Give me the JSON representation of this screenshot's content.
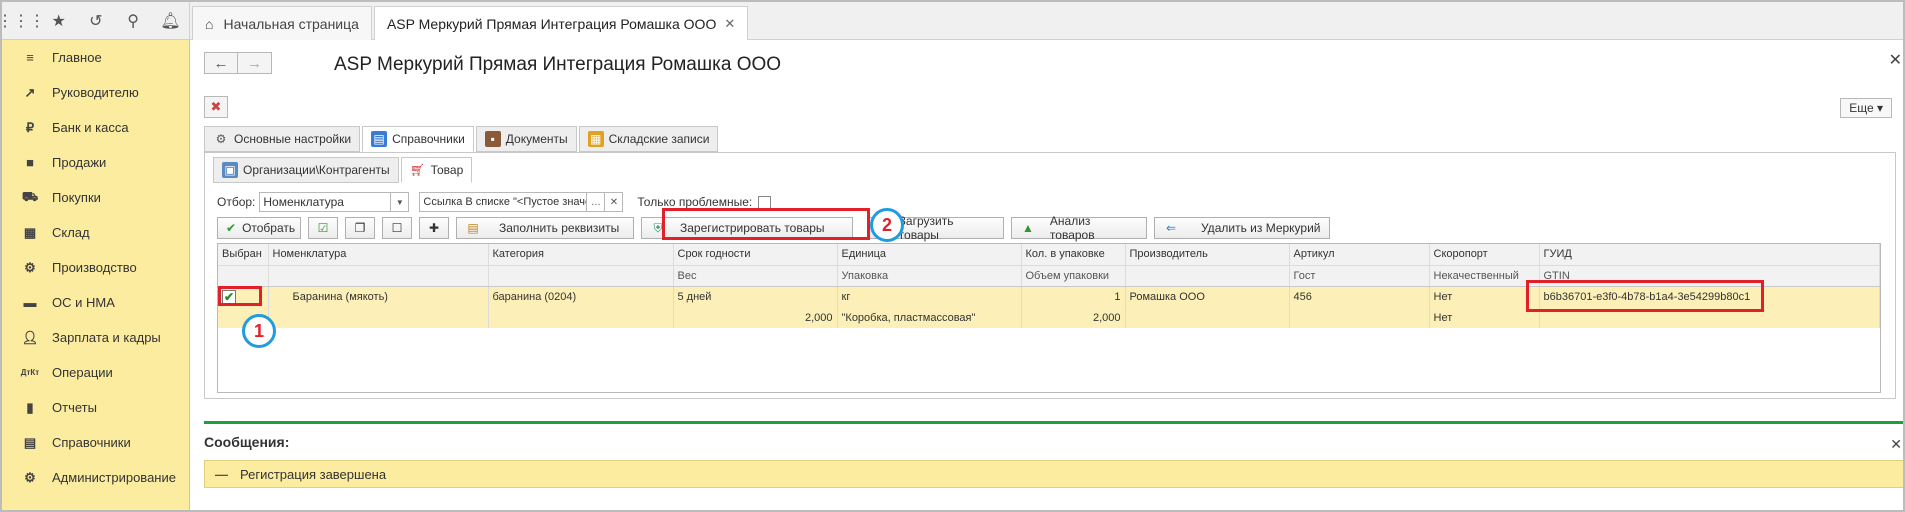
{
  "topbar": {
    "icons": [
      "grid-icon",
      "star-icon",
      "history-icon",
      "search-icon",
      "bell-icon"
    ],
    "tabs": [
      {
        "label": "Начальная страница",
        "active": false
      },
      {
        "label": "ASP Меркурий Прямая Интеграция Ромашка ООО",
        "active": true
      }
    ]
  },
  "sidebar": {
    "items": [
      {
        "label": "Главное",
        "icon": "menu-icon"
      },
      {
        "label": "Руководителю",
        "icon": "trend-icon"
      },
      {
        "label": "Банк и касса",
        "icon": "ruble-icon"
      },
      {
        "label": "Продажи",
        "icon": "bag-icon"
      },
      {
        "label": "Покупки",
        "icon": "cart-icon"
      },
      {
        "label": "Склад",
        "icon": "warehouse-icon"
      },
      {
        "label": "Производство",
        "icon": "factory-icon"
      },
      {
        "label": "ОС и НМА",
        "icon": "truck-icon"
      },
      {
        "label": "Зарплата и кадры",
        "icon": "person-icon"
      },
      {
        "label": "Операции",
        "icon": "dtkt-icon"
      },
      {
        "label": "Отчеты",
        "icon": "barchart-icon"
      },
      {
        "label": "Справочники",
        "icon": "book-icon"
      },
      {
        "label": "Администрирование",
        "icon": "gear-icon"
      }
    ]
  },
  "main": {
    "title": "ASP Меркурий Прямая Интеграция Ромашка ООО",
    "more_label": "Еще ▾",
    "tabs": [
      {
        "label": "Основные настройки",
        "active": false
      },
      {
        "label": "Справочники",
        "active": true
      },
      {
        "label": "Документы",
        "active": false
      },
      {
        "label": "Складские записи",
        "active": false
      }
    ],
    "subtabs": [
      {
        "label": "Организации\\Контрагенты",
        "active": false
      },
      {
        "label": "Товар",
        "active": true
      }
    ],
    "filter": {
      "label": "Отбор:",
      "field_value": "Номенклатура",
      "condition_value": "Ссылка В списке \"<Пустое значение>; ...",
      "problem_only_label": "Только проблемные:"
    },
    "buttons": {
      "select": "Отобрать",
      "fill": "Заполнить реквизиты",
      "register": "Зарегистрировать товары",
      "load": "Загрузить товары",
      "analyze": "Анализ товаров",
      "delete": "Удалить из Меркурий"
    },
    "table": {
      "headers_row1": [
        "Выбран",
        "Номенклатура",
        "Категория",
        "Срок годности",
        "Единица",
        "Кол. в упаковке",
        "Производитель",
        "Артикул",
        "Скоропорт",
        "ГУИД"
      ],
      "headers_row2": [
        "",
        "",
        "",
        "Вес",
        "Упаковка",
        "Объем упаковки",
        "",
        "Гост",
        "Некачественный",
        "GTIN"
      ],
      "row1": [
        "",
        "Баранина (мякоть)",
        "баранина (0204)",
        "5 дней",
        "кг",
        "1",
        "Ромашка ООО",
        "456",
        "Нет",
        "b6b36701-e3f0-4b78-b1a4-3e54299b80c1"
      ],
      "row2": [
        "",
        "",
        "",
        "2,000",
        "\"Коробка, пластмассовая\"",
        "2,000",
        "",
        "",
        "Нет",
        ""
      ]
    }
  },
  "annotations": {
    "badge1": "1",
    "badge2": "2"
  },
  "messages": {
    "title": "Сообщения:",
    "text": "Регистрация завершена"
  },
  "colors": {
    "sidebar_bg": "#fbeca0",
    "highlight_red": "#e2202a",
    "badge_blue": "#1f9be0",
    "accent_green": "#1aa040"
  }
}
